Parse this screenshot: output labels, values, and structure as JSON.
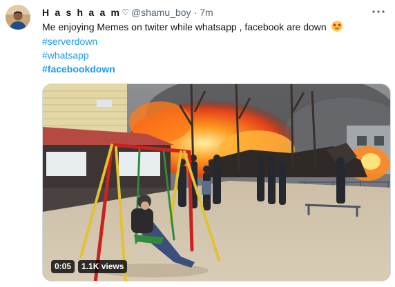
{
  "author": {
    "display_name": "H a s h a a m",
    "name_symbol": "♡",
    "handle": "@shamu_boy",
    "separator": "·",
    "time": "7m"
  },
  "tweet": {
    "text": "Me enjoying Memes on twiter while whatsapp , facebook are down",
    "emoji": "star-struck-icon",
    "hashtags": [
      "#serverdown",
      "#whatsapp",
      "#facebookdown"
    ]
  },
  "media": {
    "type": "video",
    "duration": "0:05",
    "views": "1.1K views"
  },
  "icons": {
    "more": "more-horizontal-icon",
    "avatar": "avatar"
  },
  "colors": {
    "link": "#1d9bf0",
    "text": "#0f1419",
    "secondary": "#536471"
  }
}
